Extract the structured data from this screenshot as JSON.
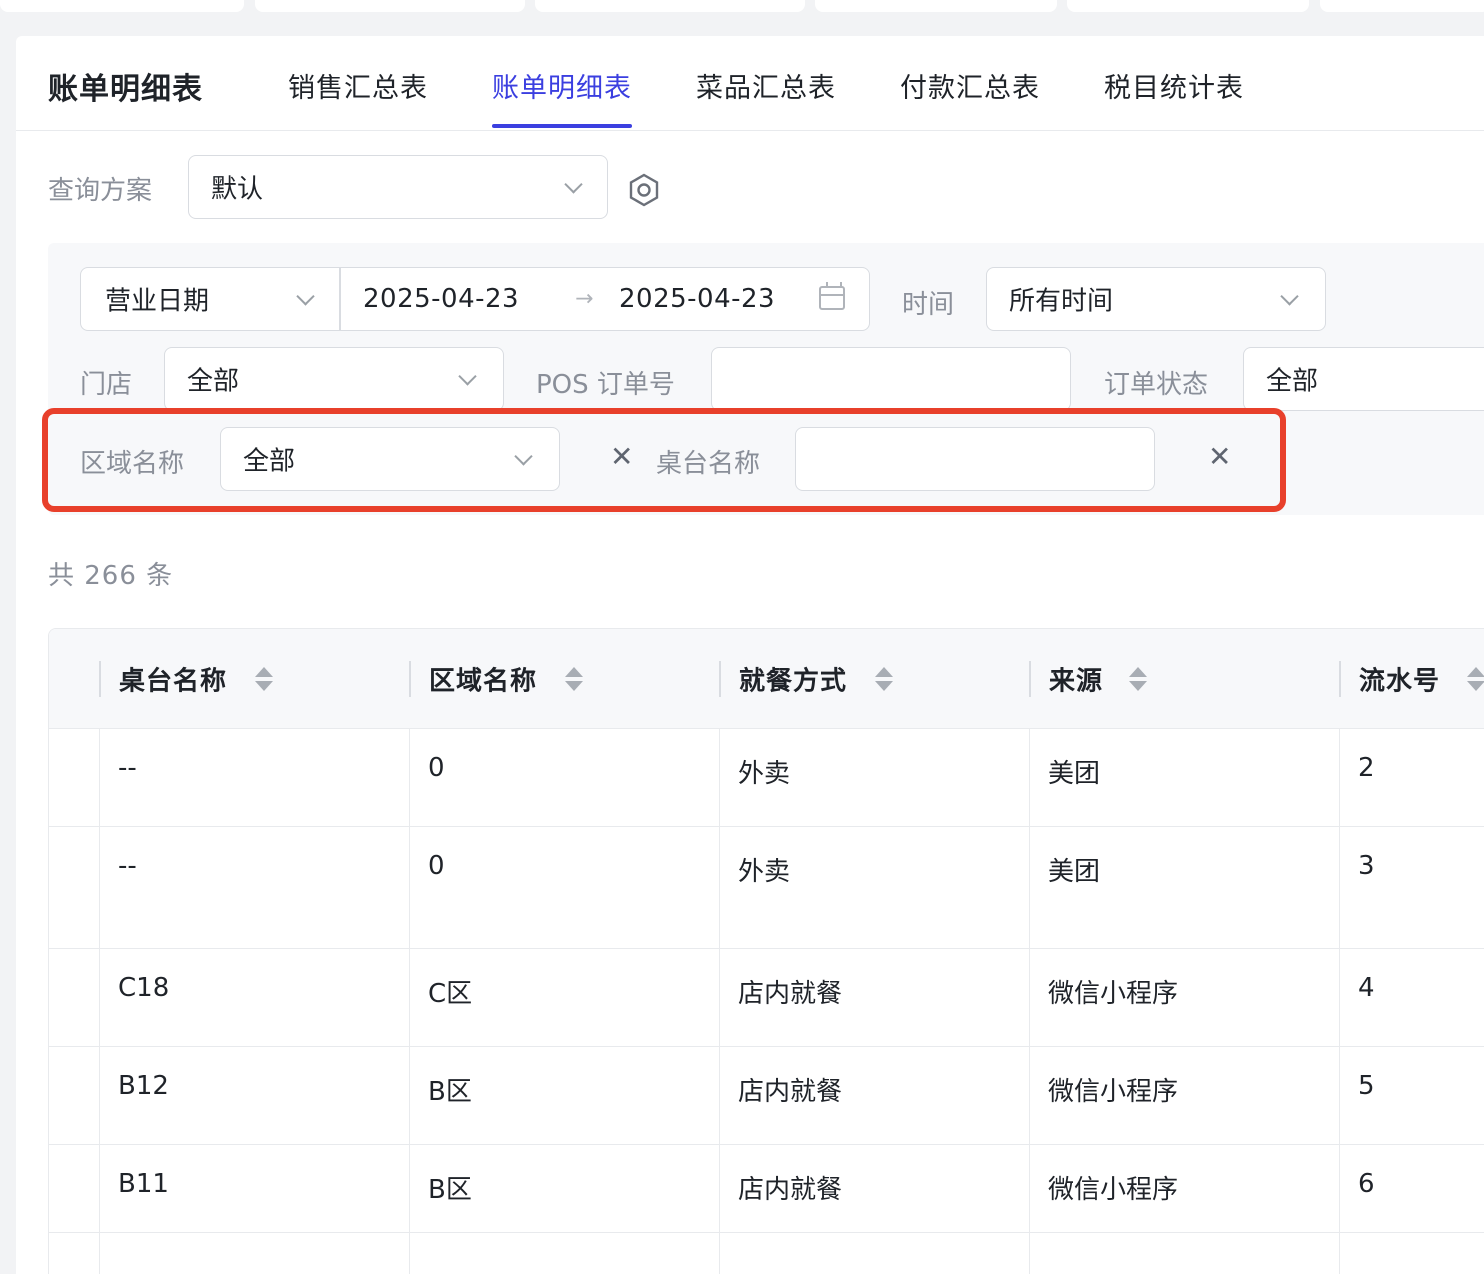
{
  "report_title": "账单明细表",
  "tabs": [
    {
      "label": "销售汇总表"
    },
    {
      "label": "账单明细表",
      "active": true
    },
    {
      "label": "菜品汇总表"
    },
    {
      "label": "付款汇总表"
    },
    {
      "label": "税目统计表"
    }
  ],
  "query_scheme": {
    "label": "查询方案",
    "value": "默认"
  },
  "filters": {
    "date_type": "营业日期",
    "date_start": "2025-04-23",
    "date_arrow": "→",
    "date_end": "2025-04-23",
    "time_label": "时间",
    "time_value": "所有时间",
    "store_label": "门店",
    "store_value": "全部",
    "pos_label": "POS 订单号",
    "pos_value": "",
    "status_label": "订单状态",
    "status_value": "全部",
    "area_label": "区域名称",
    "area_value": "全部",
    "table_label": "桌台名称",
    "table_value": ""
  },
  "count_text": "共 266 条",
  "table": {
    "columns": [
      "桌台名称",
      "区域名称",
      "就餐方式",
      "来源",
      "流水号"
    ],
    "rows": [
      [
        "--",
        "0",
        "外卖",
        "美团",
        "2"
      ],
      [
        "--",
        "0",
        "外卖",
        "美团",
        "3"
      ],
      [
        "C18",
        "C区",
        "店内就餐",
        "微信小程序",
        "4"
      ],
      [
        "B12",
        "B区",
        "店内就餐",
        "微信小程序",
        "5"
      ],
      [
        "B11",
        "B区",
        "店内就餐",
        "微信小程序",
        "6"
      ]
    ]
  },
  "colors": {
    "accent": "#3b3fe0",
    "highlight": "#e8402b"
  },
  "icons": [
    "chevron-down-icon",
    "settings-icon",
    "calendar-icon",
    "close-icon",
    "sort-icon"
  ]
}
